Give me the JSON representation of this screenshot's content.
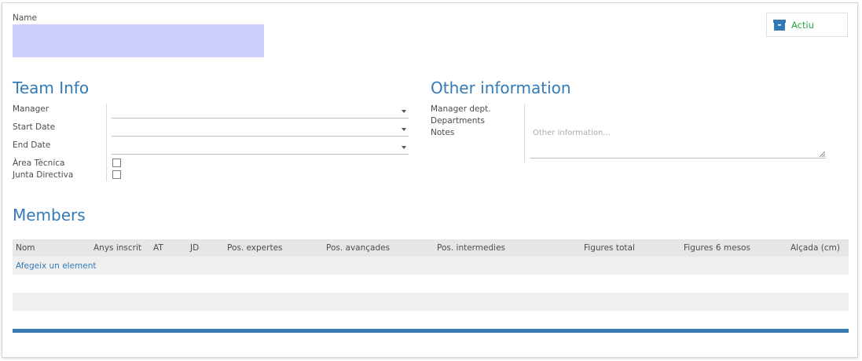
{
  "form": {
    "name_label": "Name",
    "name_value": "",
    "status_button": {
      "label": "Actiu",
      "icon": "archive-box-icon",
      "icon_color": "#337ab7",
      "text_color": "#28a745"
    }
  },
  "team_info": {
    "title": "Team Info",
    "fields": {
      "manager": {
        "label": "Manager",
        "value": ""
      },
      "start_date": {
        "label": "Start Date",
        "value": ""
      },
      "end_date": {
        "label": "End Date",
        "value": ""
      },
      "area_tecnica": {
        "label": "Àrea Tècnica",
        "checked": false
      },
      "junta_directiva": {
        "label": "Junta Directiva",
        "checked": false
      }
    }
  },
  "other_information": {
    "title": "Other information",
    "manager_dept_label": "Manager dept.",
    "departments_label": "Departments",
    "notes_label": "Notes",
    "notes_placeholder": "Other information..."
  },
  "members": {
    "title": "Members",
    "columns": [
      "Nom",
      "Anys inscrit",
      "AT",
      "JD",
      "Pos. expertes",
      "Pos. avançades",
      "Pos. intermedies",
      "Figures total",
      "Figures 6 mesos",
      "Alçada (cm)"
    ],
    "add_link": "Afegeix un element"
  },
  "colors": {
    "accent": "#337ab7",
    "name_field_bg": "#cfcffe",
    "bottom_bar": "#3a7ab5"
  }
}
